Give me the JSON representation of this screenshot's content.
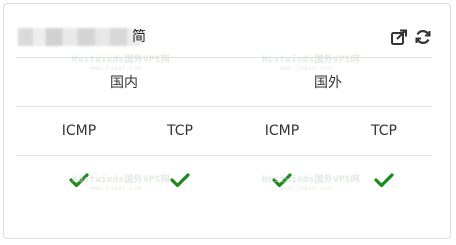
{
  "panel": {
    "title_tail": "简",
    "actions": [
      {
        "name": "share-icon"
      },
      {
        "name": "refresh-icon"
      }
    ]
  },
  "groups": [
    {
      "label": "国内"
    },
    {
      "label": "国外"
    }
  ],
  "columns": [
    {
      "label": "ICMP",
      "status": "ok"
    },
    {
      "label": "TCP",
      "status": "ok"
    },
    {
      "label": "ICMP",
      "status": "ok"
    },
    {
      "label": "TCP",
      "status": "ok"
    }
  ],
  "watermark": {
    "text": "Hostwinds国外VPS网",
    "url": "www.fobar.com"
  },
  "colors": {
    "check": "#1a8a1a",
    "icon": "#333333",
    "divider": "#e3e3e3"
  }
}
